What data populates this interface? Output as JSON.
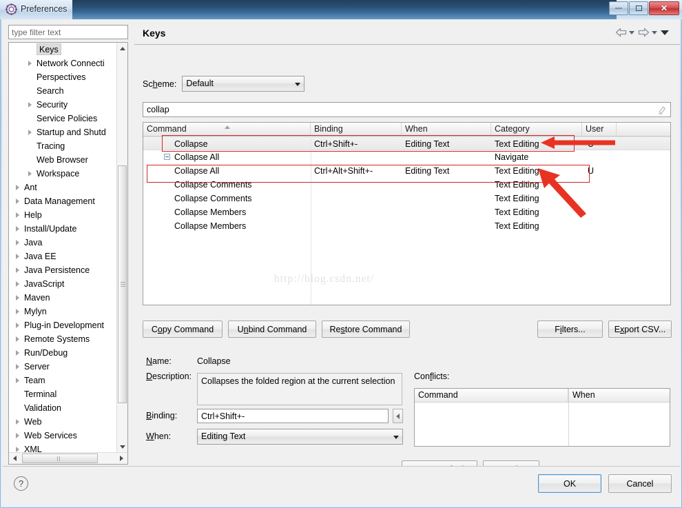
{
  "window": {
    "title": "Preferences",
    "icon": "preferences-gear-icon",
    "buttons": {
      "minimize": "minimize-icon",
      "restore": "restore-icon",
      "close": "close-icon"
    }
  },
  "sidebar": {
    "filter_placeholder": "type filter text",
    "filter_value": "",
    "items": [
      {
        "label": "Keys",
        "level": 1,
        "expandable": false,
        "selected": true
      },
      {
        "label": "Network Connecti",
        "level": 1,
        "expandable": true,
        "selected": false
      },
      {
        "label": "Perspectives",
        "level": 1,
        "expandable": false,
        "selected": false
      },
      {
        "label": "Search",
        "level": 1,
        "expandable": false,
        "selected": false
      },
      {
        "label": "Security",
        "level": 1,
        "expandable": true,
        "selected": false
      },
      {
        "label": "Service Policies",
        "level": 1,
        "expandable": false,
        "selected": false
      },
      {
        "label": "Startup and Shutd",
        "level": 1,
        "expandable": true,
        "selected": false
      },
      {
        "label": "Tracing",
        "level": 1,
        "expandable": false,
        "selected": false
      },
      {
        "label": "Web Browser",
        "level": 1,
        "expandable": false,
        "selected": false
      },
      {
        "label": "Workspace",
        "level": 1,
        "expandable": true,
        "selected": false
      },
      {
        "label": "Ant",
        "level": 0,
        "expandable": true,
        "selected": false
      },
      {
        "label": "Data Management",
        "level": 0,
        "expandable": true,
        "selected": false
      },
      {
        "label": "Help",
        "level": 0,
        "expandable": true,
        "selected": false
      },
      {
        "label": "Install/Update",
        "level": 0,
        "expandable": true,
        "selected": false
      },
      {
        "label": "Java",
        "level": 0,
        "expandable": true,
        "selected": false
      },
      {
        "label": "Java EE",
        "level": 0,
        "expandable": true,
        "selected": false
      },
      {
        "label": "Java Persistence",
        "level": 0,
        "expandable": true,
        "selected": false
      },
      {
        "label": "JavaScript",
        "level": 0,
        "expandable": true,
        "selected": false
      },
      {
        "label": "Maven",
        "level": 0,
        "expandable": true,
        "selected": false
      },
      {
        "label": "Mylyn",
        "level": 0,
        "expandable": true,
        "selected": false
      },
      {
        "label": "Plug-in Development",
        "level": 0,
        "expandable": true,
        "selected": false
      },
      {
        "label": "Remote Systems",
        "level": 0,
        "expandable": true,
        "selected": false
      },
      {
        "label": "Run/Debug",
        "level": 0,
        "expandable": true,
        "selected": false
      },
      {
        "label": "Server",
        "level": 0,
        "expandable": true,
        "selected": false
      },
      {
        "label": "Team",
        "level": 0,
        "expandable": true,
        "selected": false
      },
      {
        "label": "Terminal",
        "level": 0,
        "expandable": false,
        "selected": false
      },
      {
        "label": "Validation",
        "level": 0,
        "expandable": false,
        "selected": false
      },
      {
        "label": "Web",
        "level": 0,
        "expandable": true,
        "selected": false
      },
      {
        "label": "Web Services",
        "level": 0,
        "expandable": true,
        "selected": false
      },
      {
        "label": "XML",
        "level": 0,
        "expandable": true,
        "selected": false
      }
    ]
  },
  "page": {
    "title": "Keys",
    "nav": {
      "back": "back-arrow-icon",
      "back_menu": "back-dropdown-icon",
      "forward": "forward-arrow-icon",
      "forward_menu": "forward-dropdown-icon",
      "menu": "view-menu-icon"
    },
    "scheme": {
      "label_pre": "Sc",
      "label_key": "h",
      "label_post": "eme:",
      "value": "Default"
    },
    "filter": {
      "value": "collap",
      "clear_icon": "eraser-icon"
    }
  },
  "keys_table": {
    "columns": [
      {
        "key": "command",
        "label": "Command",
        "sorted": "asc"
      },
      {
        "key": "binding",
        "label": "Binding",
        "sorted": ""
      },
      {
        "key": "when",
        "label": "When",
        "sorted": ""
      },
      {
        "key": "category",
        "label": "Category",
        "sorted": ""
      },
      {
        "key": "user",
        "label": "User",
        "sorted": ""
      }
    ],
    "rows": [
      {
        "command": "Collapse",
        "binding": "Ctrl+Shift+-",
        "when": "Editing Text",
        "category": "Text Editing",
        "user": "U",
        "selected": true,
        "expander": false,
        "indent": 1
      },
      {
        "command": "Collapse All",
        "binding": "",
        "when": "",
        "category": "Navigate",
        "user": "",
        "selected": false,
        "expander": true,
        "indent": 1
      },
      {
        "command": "Collapse All",
        "binding": "Ctrl+Alt+Shift+-",
        "when": "Editing Text",
        "category": "Text Editing",
        "user": "U",
        "selected": false,
        "expander": false,
        "indent": 1
      },
      {
        "command": "Collapse Comments",
        "binding": "",
        "when": "",
        "category": "Text Editing",
        "user": "",
        "selected": false,
        "expander": false,
        "indent": 1
      },
      {
        "command": "Collapse Comments",
        "binding": "",
        "when": "",
        "category": "Text Editing",
        "user": "",
        "selected": false,
        "expander": false,
        "indent": 1
      },
      {
        "command": "Collapse Members",
        "binding": "",
        "when": "",
        "category": "Text Editing",
        "user": "",
        "selected": false,
        "expander": false,
        "indent": 1
      },
      {
        "command": "Collapse Members",
        "binding": "",
        "when": "",
        "category": "Text Editing",
        "user": "",
        "selected": false,
        "expander": false,
        "indent": 1
      }
    ],
    "watermark": "http://blog.csdn.net/"
  },
  "command_buttons": {
    "copy": {
      "pre": "C",
      "key": "o",
      "post": "py Command"
    },
    "unbind": {
      "pre": "U",
      "key": "n",
      "post": "bind Command"
    },
    "restore": {
      "pre": "Re",
      "key": "s",
      "post": "tore Command"
    },
    "filters": {
      "pre": "F",
      "key": "i",
      "post": "lters..."
    },
    "export": {
      "pre": "E",
      "key": "x",
      "post": "port CSV..."
    }
  },
  "details": {
    "name_label": {
      "key": "N",
      "post": "ame:"
    },
    "name_value": "Collapse",
    "description_label": {
      "key": "D",
      "post": "escription:"
    },
    "description_value": "Collapses the folded region at the current selection",
    "binding_label": {
      "key": "B",
      "post": "inding:"
    },
    "binding_value": "Ctrl+Shift+-",
    "binding_side_icon": "binding-prev-icon",
    "when_label": {
      "key": "W",
      "post": "hen:"
    },
    "when_value": "Editing Text",
    "conflicts_label_pre": "Con",
    "conflicts_label_key": "f",
    "conflicts_label_post": "licts:",
    "conflicts_columns": [
      "Command",
      "When"
    ],
    "conflicts_rows": []
  },
  "footer": {
    "restore_defaults": {
      "pre": "Restore ",
      "key": "D",
      "post": "efaults"
    },
    "apply": {
      "pre": "",
      "key": "A",
      "post": "pply"
    },
    "help_icon": "help-icon",
    "ok": "OK",
    "cancel": "Cancel"
  },
  "colors": {
    "annotation": "#cf2424",
    "titlebar_dark": "#1b4368",
    "close_button": "#c03030",
    "selection": "#dcdcdc"
  }
}
